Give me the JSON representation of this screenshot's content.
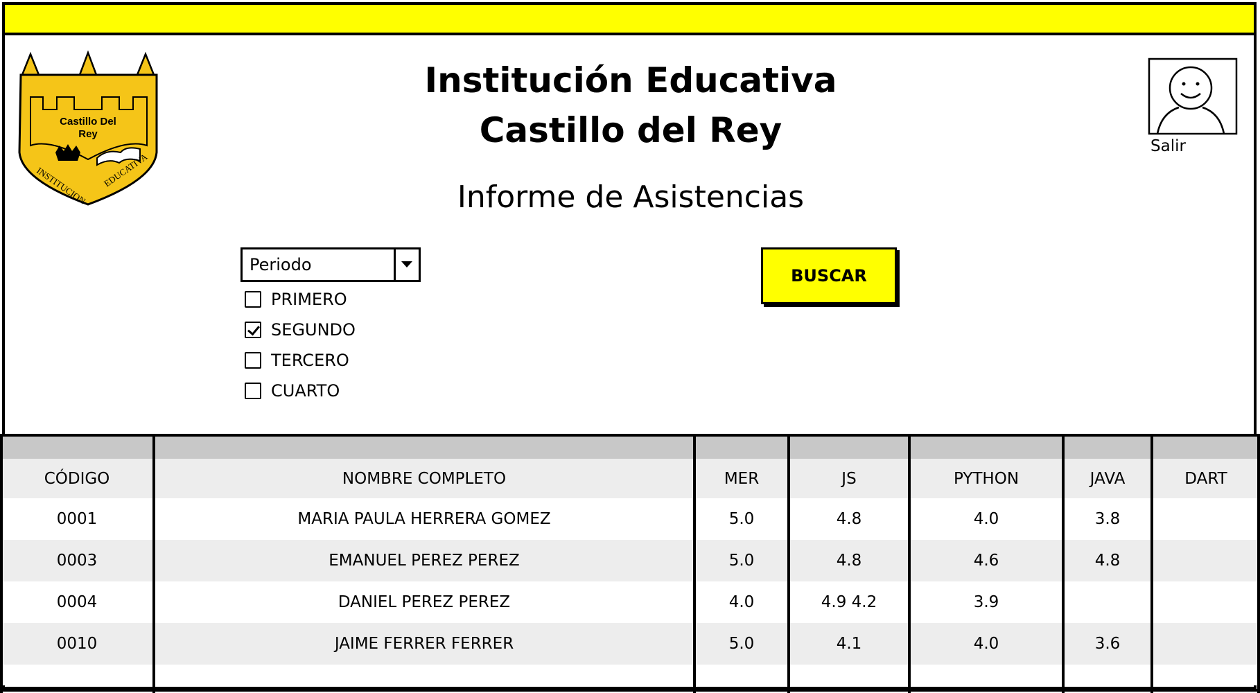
{
  "header": {
    "title_line1": "Institución Educativa",
    "title_line2": "Castillo del Rey",
    "subtitle": "Informe de Asistencias",
    "logout_label": "Salir",
    "logo_text_line1": "Castillo Del",
    "logo_text_line2": "Rey",
    "logo_arc_left": "INSTITUCION",
    "logo_arc_right": "EDUCATIVA"
  },
  "colors": {
    "accent": "#ffff00",
    "header_bar": "#c8c8c8",
    "row_alt": "#ededed",
    "logo": "#f5c518"
  },
  "filter": {
    "select_value": "Periodo",
    "options": [
      {
        "label": "PRIMERO",
        "checked": false
      },
      {
        "label": "SEGUNDO",
        "checked": true
      },
      {
        "label": "TERCERO",
        "checked": false
      },
      {
        "label": "CUARTO",
        "checked": false
      }
    ],
    "search_label": "BUSCAR"
  },
  "table": {
    "columns": [
      "CÓDIGO",
      "NOMBRE COMPLETO",
      "MER",
      "JS",
      "PYTHON",
      "JAVA",
      "DART"
    ],
    "rows": [
      [
        "0001",
        "MARIA PAULA HERRERA GOMEZ",
        "5.0",
        "4.8",
        "4.0",
        "3.8",
        ""
      ],
      [
        "0003",
        "EMANUEL PEREZ PEREZ",
        "5.0",
        "4.8",
        "4.6",
        "4.8",
        ""
      ],
      [
        "0004",
        "DANIEL PEREZ PEREZ",
        "4.0",
        "4.9 4.2",
        "3.9",
        "",
        ""
      ],
      [
        "0010",
        "JAIME FERRER FERRER",
        "5.0",
        "4.1",
        "4.0",
        "3.6",
        ""
      ]
    ]
  },
  "icons": {
    "avatar": "user-avatar-icon",
    "dropdown": "chevron-down-icon",
    "check": "checkmark-icon"
  }
}
